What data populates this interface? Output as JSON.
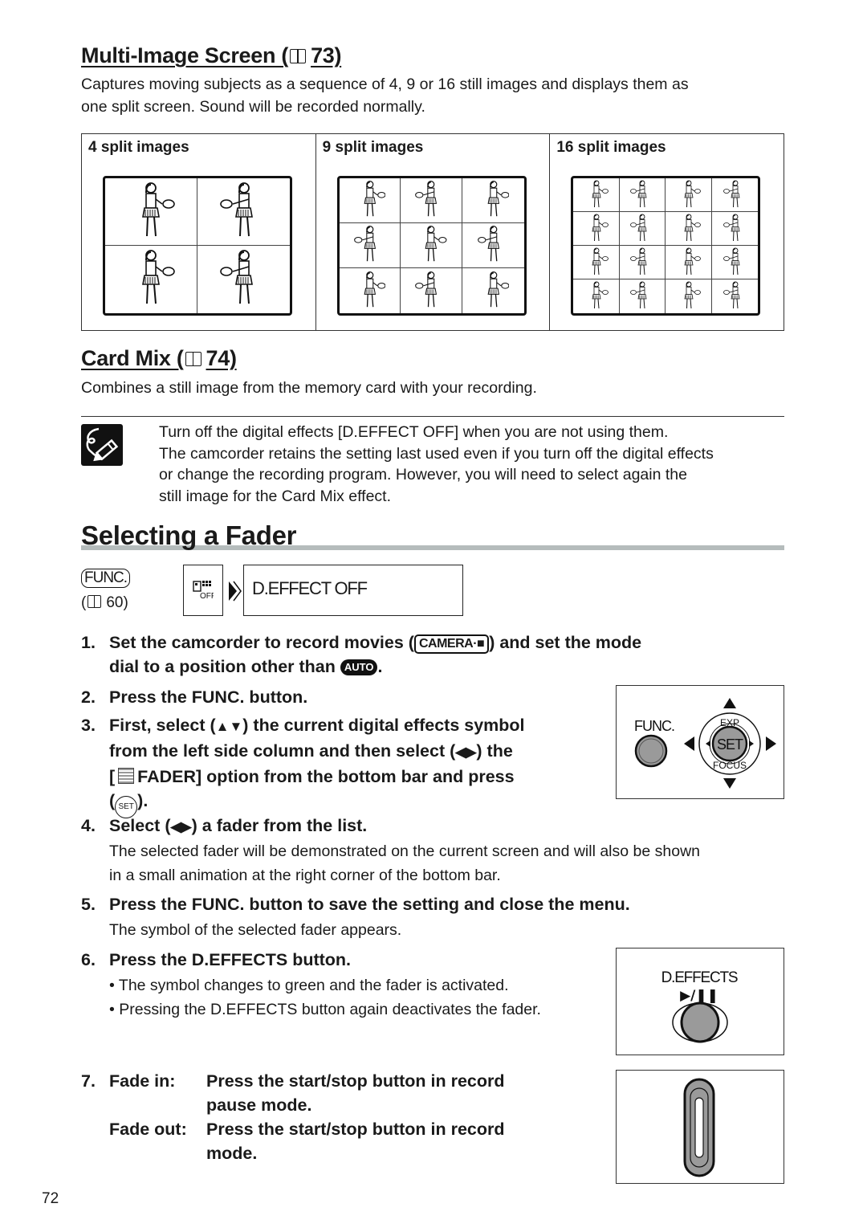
{
  "multi_image": {
    "heading": "Multi-Image Screen (",
    "ref_page": "73)",
    "description_line1": "Captures moving subjects as a sequence of 4, 9 or 16 still images and displays them as",
    "description_line2": "one split screen. Sound will be recorded normally.",
    "columns": [
      {
        "label": "4 split images",
        "grid": 2
      },
      {
        "label": "9 split images",
        "grid": 3
      },
      {
        "label": "16 split images",
        "grid": 4
      }
    ]
  },
  "card_mix": {
    "heading": "Card Mix (",
    "ref_page": "74)",
    "description": "Combines a still image from the memory card with your recording."
  },
  "note": {
    "icon": "pencil-note-icon",
    "lines": [
      "Turn off the digital effects [D.EFFECT OFF] when you are not using them.",
      "The camcorder retains the setting last used even if you turn off the digital effects",
      "or change the recording program. However, you will need to select again the",
      "still image for the Card Mix effect."
    ]
  },
  "section": {
    "title": "Selecting a Fader"
  },
  "func_menu": {
    "func_label": "FUNC.",
    "func_ref_open": "(",
    "func_ref_page": "60)",
    "menu_icon": "d-effect-off-icon",
    "menu_value": "D.EFFECT OFF"
  },
  "steps": {
    "s1": {
      "num": "1.",
      "part1": "Set the camcorder to record movies (",
      "badge": "CAMERA·■",
      "part2": ") and set the mode",
      "line2a": "dial to a position other than",
      "auto": "AUTO",
      "line2b": "."
    },
    "s2": {
      "num": "2.",
      "text": "Press the FUNC. button."
    },
    "s3": {
      "num": "3.",
      "line1a": "First, select (",
      "updown": "▲▼",
      "line1b": ") the current digital effects symbol",
      "line2a": "from the left side column and then select (",
      "leftright": "◀▶",
      "line2b": ") the",
      "line3a": "[",
      "line3b": "FADER] option from the bottom bar and press",
      "line4a": "(",
      "set": "SET",
      "line4b": ")."
    },
    "s4": {
      "num": "4.",
      "a": "Select (",
      "leftright": "◀▶",
      "b": ") a fader from the list.",
      "sub1": "The selected fader will be demonstrated on the current screen and will also be shown",
      "sub2": "in a small animation at the right corner of the bottom bar."
    },
    "s5": {
      "num": "5.",
      "text": "Press the FUNC. button to save the setting and close the menu.",
      "sub": "The symbol of the selected fader appears."
    },
    "s6": {
      "num": "6.",
      "text": "Press the D.EFFECTS button.",
      "bullets": [
        "The symbol changes to green and the fader is activated.",
        "Pressing the D.EFFECTS button again deactivates the fader."
      ]
    },
    "s7": {
      "num": "7.",
      "fade_in_label": "Fade in:",
      "fade_in_1": "Press the start/stop button in record",
      "fade_in_2": "pause mode.",
      "fade_out_label": "Fade out:",
      "fade_out_1": "Press the start/stop button in record",
      "fade_out_2": "mode."
    }
  },
  "illustrations": {
    "func_panel": {
      "func_label": "FUNC.",
      "top_label": "EXP",
      "center_label": "SET",
      "bottom_label": "FOCUS"
    },
    "deffects_panel": {
      "label": "D.EFFECTS",
      "sub_label": "▶/❚❚"
    }
  },
  "page_number": "72"
}
